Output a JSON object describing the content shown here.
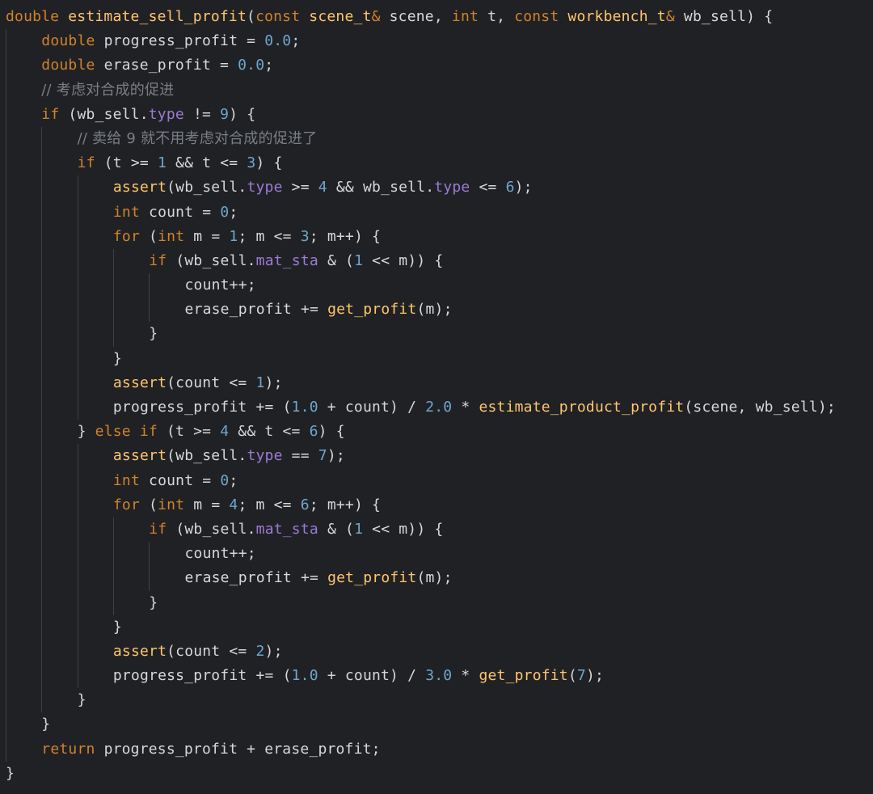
{
  "theme": {
    "background": "#202124",
    "keyword": "#d0832c",
    "function": "#ffc66d",
    "number": "#6ea6cf",
    "member": "#9d7ad6",
    "comment": "#7a7e85",
    "plain": "#d8d8d8"
  },
  "code_lines": [
    {
      "indent": 0,
      "tokens": [
        [
          "k",
          "double "
        ],
        [
          "f",
          "estimate_sell_profit"
        ],
        [
          "p",
          "("
        ],
        [
          "k",
          "const "
        ],
        [
          "f",
          "scene_t"
        ],
        [
          "k",
          "& "
        ],
        [
          "p",
          "scene, "
        ],
        [
          "k",
          "int "
        ],
        [
          "p",
          "t, "
        ],
        [
          "k",
          "const "
        ],
        [
          "f",
          "workbench_t"
        ],
        [
          "k",
          "& "
        ],
        [
          "p",
          "wb_sell) {"
        ]
      ]
    },
    {
      "indent": 1,
      "tokens": [
        [
          "k",
          "double "
        ],
        [
          "p",
          "progress_profit = "
        ],
        [
          "n",
          "0.0"
        ],
        [
          "p",
          ";"
        ]
      ]
    },
    {
      "indent": 1,
      "tokens": [
        [
          "k",
          "double "
        ],
        [
          "p",
          "erase_profit = "
        ],
        [
          "n",
          "0.0"
        ],
        [
          "p",
          ";"
        ]
      ]
    },
    {
      "indent": 1,
      "tokens": [
        [
          "c",
          "// 考虑对合成的促进"
        ]
      ]
    },
    {
      "indent": 1,
      "tokens": [
        [
          "k",
          "if "
        ],
        [
          "p",
          "(wb_sell."
        ],
        [
          "m",
          "type"
        ],
        [
          "p",
          " != "
        ],
        [
          "n",
          "9"
        ],
        [
          "p",
          ") {"
        ]
      ]
    },
    {
      "indent": 2,
      "tokens": [
        [
          "c",
          "// 卖给 9 就不用考虑对合成的促进了"
        ]
      ]
    },
    {
      "indent": 2,
      "tokens": [
        [
          "k",
          "if "
        ],
        [
          "p",
          "(t >= "
        ],
        [
          "n",
          "1"
        ],
        [
          "p",
          " && t <= "
        ],
        [
          "n",
          "3"
        ],
        [
          "p",
          ") {"
        ]
      ]
    },
    {
      "indent": 3,
      "tokens": [
        [
          "f",
          "assert"
        ],
        [
          "p",
          "(wb_sell."
        ],
        [
          "m",
          "type"
        ],
        [
          "p",
          " >= "
        ],
        [
          "n",
          "4"
        ],
        [
          "p",
          " && wb_sell."
        ],
        [
          "m",
          "type"
        ],
        [
          "p",
          " <= "
        ],
        [
          "n",
          "6"
        ],
        [
          "p",
          ");"
        ]
      ]
    },
    {
      "indent": 3,
      "tokens": [
        [
          "k",
          "int "
        ],
        [
          "p",
          "count = "
        ],
        [
          "n",
          "0"
        ],
        [
          "p",
          ";"
        ]
      ]
    },
    {
      "indent": 3,
      "tokens": [
        [
          "k",
          "for "
        ],
        [
          "p",
          "("
        ],
        [
          "k",
          "int "
        ],
        [
          "p",
          "m = "
        ],
        [
          "n",
          "1"
        ],
        [
          "p",
          "; m <= "
        ],
        [
          "n",
          "3"
        ],
        [
          "p",
          "; m++) {"
        ]
      ]
    },
    {
      "indent": 4,
      "tokens": [
        [
          "k",
          "if "
        ],
        [
          "p",
          "(wb_sell."
        ],
        [
          "m",
          "mat_sta"
        ],
        [
          "p",
          " & ("
        ],
        [
          "n",
          "1"
        ],
        [
          "p",
          " << m)) {"
        ]
      ]
    },
    {
      "indent": 5,
      "tokens": [
        [
          "p",
          "count++;"
        ]
      ]
    },
    {
      "indent": 5,
      "tokens": [
        [
          "p",
          "erase_profit += "
        ],
        [
          "f",
          "get_profit"
        ],
        [
          "p",
          "(m);"
        ]
      ]
    },
    {
      "indent": 4,
      "tokens": [
        [
          "p",
          "}"
        ]
      ]
    },
    {
      "indent": 3,
      "tokens": [
        [
          "p",
          "}"
        ]
      ]
    },
    {
      "indent": 3,
      "tokens": [
        [
          "f",
          "assert"
        ],
        [
          "p",
          "(count <= "
        ],
        [
          "n",
          "1"
        ],
        [
          "p",
          ");"
        ]
      ]
    },
    {
      "indent": 3,
      "tokens": [
        [
          "p",
          "progress_profit += ("
        ],
        [
          "n",
          "1.0"
        ],
        [
          "p",
          " + count) / "
        ],
        [
          "n",
          "2.0"
        ],
        [
          "p",
          " * "
        ],
        [
          "f",
          "estimate_product_profit"
        ],
        [
          "p",
          "(scene, wb_sell);"
        ]
      ]
    },
    {
      "indent": 2,
      "tokens": [
        [
          "p",
          "} "
        ],
        [
          "k",
          "else if "
        ],
        [
          "p",
          "(t >= "
        ],
        [
          "n",
          "4"
        ],
        [
          "p",
          " && t <= "
        ],
        [
          "n",
          "6"
        ],
        [
          "p",
          ") {"
        ]
      ]
    },
    {
      "indent": 3,
      "tokens": [
        [
          "f",
          "assert"
        ],
        [
          "p",
          "(wb_sell."
        ],
        [
          "m",
          "type"
        ],
        [
          "p",
          " == "
        ],
        [
          "n",
          "7"
        ],
        [
          "p",
          ");"
        ]
      ]
    },
    {
      "indent": 3,
      "tokens": [
        [
          "k",
          "int "
        ],
        [
          "p",
          "count = "
        ],
        [
          "n",
          "0"
        ],
        [
          "p",
          ";"
        ]
      ]
    },
    {
      "indent": 3,
      "tokens": [
        [
          "k",
          "for "
        ],
        [
          "p",
          "("
        ],
        [
          "k",
          "int "
        ],
        [
          "p",
          "m = "
        ],
        [
          "n",
          "4"
        ],
        [
          "p",
          "; m <= "
        ],
        [
          "n",
          "6"
        ],
        [
          "p",
          "; m++) {"
        ]
      ]
    },
    {
      "indent": 4,
      "tokens": [
        [
          "k",
          "if "
        ],
        [
          "p",
          "(wb_sell."
        ],
        [
          "m",
          "mat_sta"
        ],
        [
          "p",
          " & ("
        ],
        [
          "n",
          "1"
        ],
        [
          "p",
          " << m)) {"
        ]
      ]
    },
    {
      "indent": 5,
      "tokens": [
        [
          "p",
          "count++;"
        ]
      ]
    },
    {
      "indent": 5,
      "tokens": [
        [
          "p",
          "erase_profit += "
        ],
        [
          "f",
          "get_profit"
        ],
        [
          "p",
          "(m);"
        ]
      ]
    },
    {
      "indent": 4,
      "tokens": [
        [
          "p",
          "}"
        ]
      ]
    },
    {
      "indent": 3,
      "tokens": [
        [
          "p",
          "}"
        ]
      ]
    },
    {
      "indent": 3,
      "tokens": [
        [
          "f",
          "assert"
        ],
        [
          "p",
          "(count <= "
        ],
        [
          "n",
          "2"
        ],
        [
          "p",
          ");"
        ]
      ]
    },
    {
      "indent": 3,
      "tokens": [
        [
          "p",
          "progress_profit += ("
        ],
        [
          "n",
          "1.0"
        ],
        [
          "p",
          " + count) / "
        ],
        [
          "n",
          "3.0"
        ],
        [
          "p",
          " * "
        ],
        [
          "f",
          "get_profit"
        ],
        [
          "p",
          "("
        ],
        [
          "n",
          "7"
        ],
        [
          "p",
          ");"
        ]
      ]
    },
    {
      "indent": 2,
      "tokens": [
        [
          "p",
          "}"
        ]
      ]
    },
    {
      "indent": 1,
      "tokens": [
        [
          "p",
          "}"
        ]
      ]
    },
    {
      "indent": 1,
      "tokens": [
        [
          "k",
          "return "
        ],
        [
          "p",
          "progress_profit + erase_profit;"
        ]
      ]
    },
    {
      "indent": 0,
      "tokens": [
        [
          "p",
          "}"
        ]
      ]
    }
  ]
}
